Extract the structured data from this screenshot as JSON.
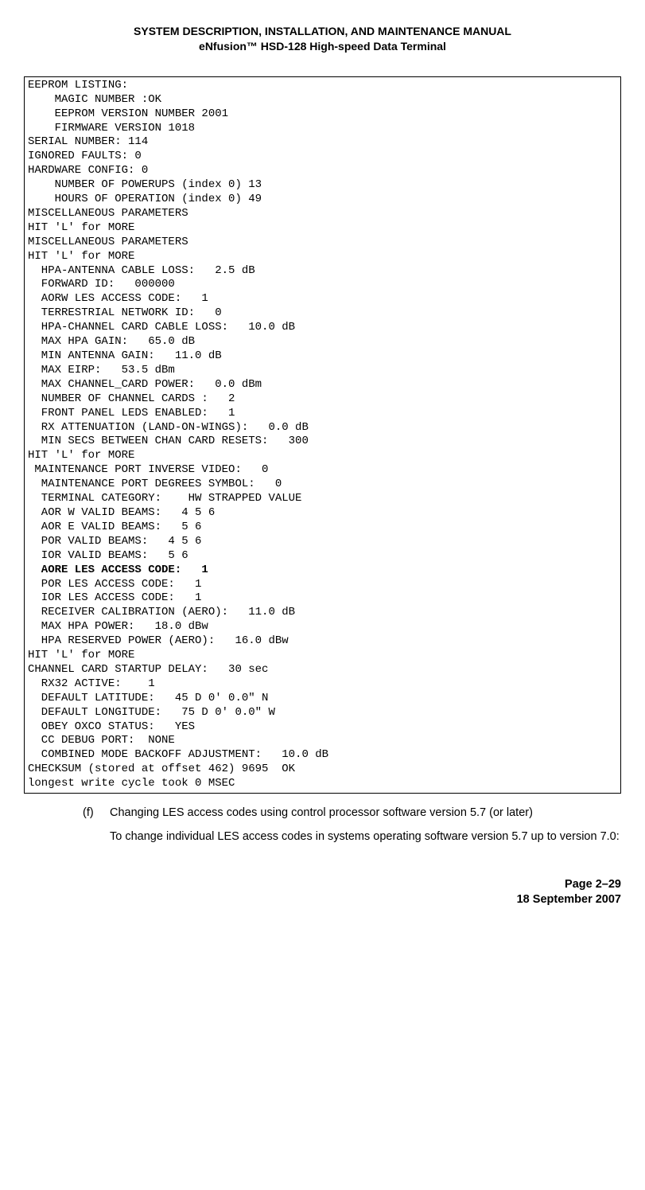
{
  "header": {
    "line1": "SYSTEM DESCRIPTION, INSTALLATION, AND MAINTENANCE MANUAL",
    "line2": "eNfusion™ HSD-128 High-speed Data Terminal"
  },
  "terminal": {
    "lines": [
      {
        "t": "EEPROM LISTING:"
      },
      {
        "t": "    MAGIC NUMBER :OK"
      },
      {
        "t": "    EEPROM VERSION NUMBER 2001"
      },
      {
        "t": "    FIRMWARE VERSION 1018"
      },
      {
        "t": "SERIAL NUMBER: 114"
      },
      {
        "t": "IGNORED FAULTS: 0"
      },
      {
        "t": "HARDWARE CONFIG: 0"
      },
      {
        "t": "    NUMBER OF POWERUPS (index 0) 13"
      },
      {
        "t": "    HOURS OF OPERATION (index 0) 49"
      },
      {
        "t": "MISCELLANEOUS PARAMETERS"
      },
      {
        "t": "HIT 'L' for MORE"
      },
      {
        "t": "MISCELLANEOUS PARAMETERS"
      },
      {
        "t": "HIT 'L' for MORE"
      },
      {
        "t": "  HPA-ANTENNA CABLE LOSS:   2.5 dB"
      },
      {
        "t": "  FORWARD ID:   000000"
      },
      {
        "t": "  AORW LES ACCESS CODE:   1"
      },
      {
        "t": "  TERRESTRIAL NETWORK ID:   0"
      },
      {
        "t": "  HPA-CHANNEL CARD CABLE LOSS:   10.0 dB"
      },
      {
        "t": "  MAX HPA GAIN:   65.0 dB"
      },
      {
        "t": "  MIN ANTENNA GAIN:   11.0 dB"
      },
      {
        "t": "  MAX EIRP:   53.5 dBm"
      },
      {
        "t": "  MAX CHANNEL_CARD POWER:   0.0 dBm"
      },
      {
        "t": "  NUMBER OF CHANNEL CARDS :   2"
      },
      {
        "t": "  FRONT PANEL LEDS ENABLED:   1"
      },
      {
        "t": "  RX ATTENUATION (LAND-ON-WINGS):   0.0 dB"
      },
      {
        "t": "  MIN SECS BETWEEN CHAN CARD RESETS:   300"
      },
      {
        "t": "HIT 'L' for MORE"
      },
      {
        "t": " MAINTENANCE PORT INVERSE VIDEO:   0"
      },
      {
        "t": "  MAINTENANCE PORT DEGREES SYMBOL:   0"
      },
      {
        "t": "  TERMINAL CATEGORY:    HW STRAPPED VALUE"
      },
      {
        "t": "  AOR W VALID BEAMS:   4 5 6"
      },
      {
        "t": "  AOR E VALID BEAMS:   5 6"
      },
      {
        "t": "  POR VALID BEAMS:   4 5 6"
      },
      {
        "t": "  IOR VALID BEAMS:   5 6"
      },
      {
        "t": "  AORE LES ACCESS CODE:   1",
        "bold": true
      },
      {
        "t": "  POR LES ACCESS CODE:   1"
      },
      {
        "t": "  IOR LES ACCESS CODE:   1"
      },
      {
        "t": "  RECEIVER CALIBRATION (AERO):   11.0 dB"
      },
      {
        "t": "  MAX HPA POWER:   18.0 dBw"
      },
      {
        "t": "  HPA RESERVED POWER (AERO):   16.0 dBw"
      },
      {
        "t": "HIT 'L' for MORE"
      },
      {
        "t": "CHANNEL CARD STARTUP DELAY:   30 sec"
      },
      {
        "t": "  RX32 ACTIVE:    1"
      },
      {
        "t": "  DEFAULT LATITUDE:   45 D 0' 0.0\" N"
      },
      {
        "t": "  DEFAULT LONGITUDE:   75 D 0' 0.0\" W"
      },
      {
        "t": "  OBEY OXCO STATUS:   YES"
      },
      {
        "t": "  CC DEBUG PORT:  NONE"
      },
      {
        "t": "  COMBINED MODE BACKOFF ADJUSTMENT:   10.0 dB"
      },
      {
        "t": "CHECKSUM (stored at offset 462) 9695  OK"
      },
      {
        "t": "longest write cycle took 0 MSEC"
      }
    ]
  },
  "instruction": {
    "marker": "(f)",
    "para1": "Changing LES access codes using control processor software version 5.7 (or later)",
    "para2": "To change individual LES access codes in systems operating software version 5.7 up to version 7.0:"
  },
  "footer": {
    "page": "Page 2–29",
    "date": "18 September 2007"
  }
}
